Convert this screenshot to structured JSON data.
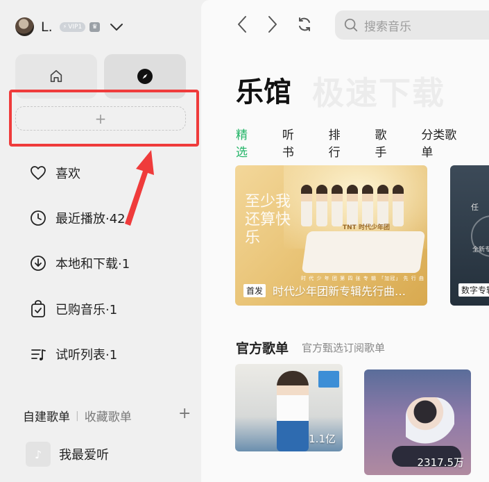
{
  "user": {
    "name": "L.",
    "vip_label": "VIP1"
  },
  "sidebar": {
    "menu": [
      {
        "label": "喜欢",
        "icon": "heart-icon"
      },
      {
        "label": "最近播放·42",
        "icon": "clock-icon"
      },
      {
        "label": "本地和下载·1",
        "icon": "download-icon"
      },
      {
        "label": "已购音乐·1",
        "icon": "purchased-bag-icon"
      },
      {
        "label": "试听列表·1",
        "icon": "playlist-icon"
      }
    ],
    "playlist_tabs": {
      "active": "自建歌单",
      "inactive": "收藏歌单"
    },
    "playlists": [
      {
        "label": "我最爱听"
      }
    ]
  },
  "toolbar": {
    "search_placeholder": "搜索音乐"
  },
  "main": {
    "title": "乐馆",
    "ghost_title": "极速下载",
    "tabs": [
      "精选",
      "听书",
      "排行",
      "歌手",
      "分类歌单"
    ],
    "active_tab": "精选",
    "banners": [
      {
        "badge": "首发",
        "caption": "时代少年团新专辑先行曲…",
        "logo_text": "TNT 时代少年团",
        "script_text": "至少我还算快乐",
        "sub_text": "时 代 少 年 团 第 四 张 专 辑 「加冠」 先 行 曲"
      },
      {
        "badge": "数字专辑",
        "ren_text": "任",
        "quan_text": "全新专"
      }
    ],
    "section": {
      "title": "官方歌单",
      "subtitle": "官方甄选订阅歌单"
    },
    "cards": [
      {
        "count": "1.1亿"
      },
      {
        "count": "2317.5万"
      }
    ]
  },
  "colors": {
    "accent": "#21b466",
    "highlight": "#ef3b3b"
  }
}
